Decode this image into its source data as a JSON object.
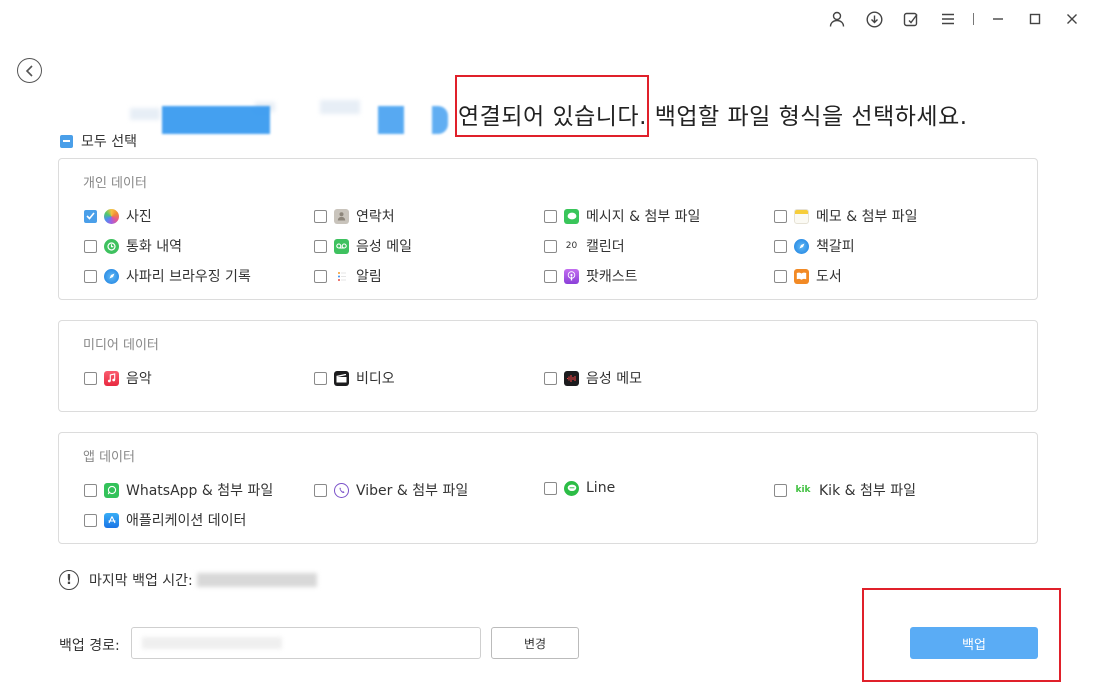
{
  "colors": {
    "accent": "#4a9fe9",
    "button": "#5aacf5",
    "highlight": "#e0202a"
  },
  "titlebar": {
    "icons": [
      "user-icon",
      "download-icon",
      "feedback-icon",
      "menu-icon",
      "minimize-icon",
      "maximize-icon",
      "close-icon"
    ]
  },
  "heading": {
    "connected": "연결되어 있습니다.",
    "rest": " 백업할 파일 형식을 선택하세요."
  },
  "select_all": "모두 선택",
  "sections": {
    "personal": {
      "title": "개인 데이터",
      "items": [
        {
          "label": "사진",
          "checked": true,
          "icon": "photos-icon"
        },
        {
          "label": "연락처",
          "checked": false,
          "icon": "contacts-icon"
        },
        {
          "label": "메시지 & 첨부 파일",
          "checked": false,
          "icon": "messages-icon"
        },
        {
          "label": "메모 & 첨부 파일",
          "checked": false,
          "icon": "notes-icon"
        },
        {
          "label": "통화 내역",
          "checked": false,
          "icon": "call-history-icon"
        },
        {
          "label": "음성 메일",
          "checked": false,
          "icon": "voicemail-icon"
        },
        {
          "label": "캘린더",
          "checked": false,
          "icon": "calendar-icon",
          "icon_text": "20"
        },
        {
          "label": "책갈피",
          "checked": false,
          "icon": "safari-bookmark-icon"
        },
        {
          "label": "사파리 브라우징 기록",
          "checked": false,
          "icon": "safari-history-icon"
        },
        {
          "label": "알림",
          "checked": false,
          "icon": "reminders-icon"
        },
        {
          "label": "팟캐스트",
          "checked": false,
          "icon": "podcasts-icon"
        },
        {
          "label": "도서",
          "checked": false,
          "icon": "books-icon"
        }
      ]
    },
    "media": {
      "title": "미디어 데이터",
      "items": [
        {
          "label": "음악",
          "checked": false,
          "icon": "music-icon"
        },
        {
          "label": "비디오",
          "checked": false,
          "icon": "video-icon"
        },
        {
          "label": "음성 메모",
          "checked": false,
          "icon": "voice-memo-icon"
        }
      ]
    },
    "app": {
      "title": "앱 데이터",
      "items": [
        {
          "label": "WhatsApp & 첨부 파일",
          "checked": false,
          "icon": "whatsapp-icon"
        },
        {
          "label": "Viber & 첨부 파일",
          "checked": false,
          "icon": "viber-icon"
        },
        {
          "label": "Line",
          "checked": false,
          "icon": "line-icon"
        },
        {
          "label": "Kik & 첨부 파일",
          "checked": false,
          "icon": "kik-icon",
          "icon_text": "kik"
        },
        {
          "label": "애플리케이션 데이터",
          "checked": false,
          "icon": "app-store-icon"
        }
      ]
    }
  },
  "last_backup": {
    "label": "마지막 백업 시간:"
  },
  "backup_path": {
    "label": "백업 경로:"
  },
  "buttons": {
    "change": "변경",
    "backup": "백업"
  }
}
